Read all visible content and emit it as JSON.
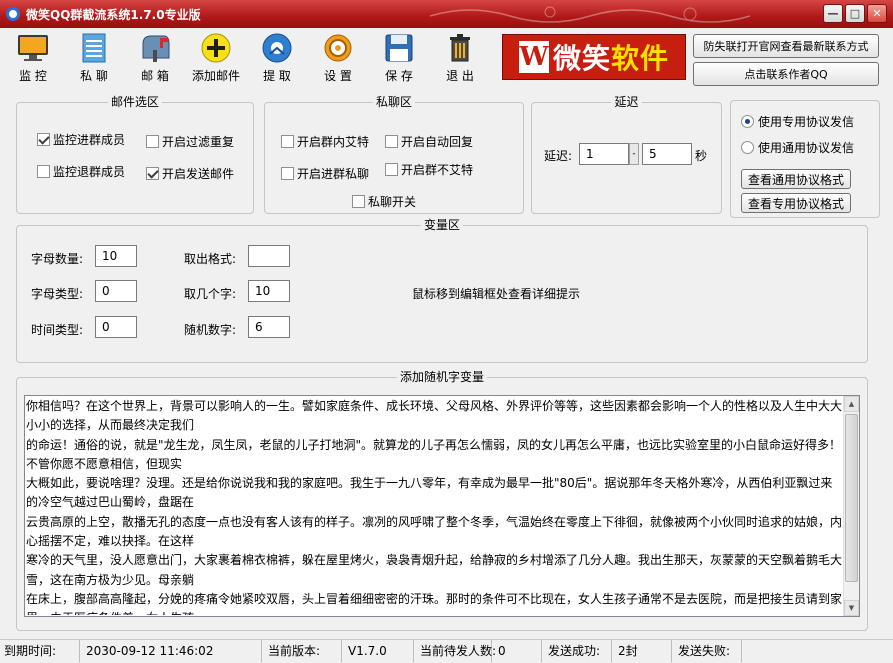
{
  "window": {
    "title": "微笑QQ群截流系统1.7.0专业版",
    "controls": [
      "—",
      "□",
      "✕"
    ]
  },
  "toolbar": {
    "items": [
      {
        "label": "监 控",
        "icon": "monitor-icon"
      },
      {
        "label": "私 聊",
        "icon": "notepad-icon"
      },
      {
        "label": "邮 箱",
        "icon": "mailbox-icon"
      },
      {
        "label": "添加邮件",
        "icon": "add-icon"
      },
      {
        "label": "提 取",
        "icon": "extract-icon"
      },
      {
        "label": "设 置",
        "icon": "gear-icon"
      },
      {
        "label": "保 存",
        "icon": "save-icon"
      },
      {
        "label": "退 出",
        "icon": "trash-icon"
      }
    ],
    "logo_w": "W",
    "logo_text_a": "微笑",
    "logo_text_b": "软件",
    "btn_official": "防失联打开官网查看最新联系方式",
    "btn_contact": "点击联系作者QQ"
  },
  "mail_group": {
    "title": "邮件选区",
    "opt_monitor_join": {
      "label": "监控进群成员",
      "checked": true
    },
    "opt_filter_dup": {
      "label": "开启过滤重复",
      "checked": false
    },
    "opt_monitor_leave": {
      "label": "监控退群成员",
      "checked": false
    },
    "opt_send_mail": {
      "label": "开启发送邮件",
      "checked": true
    }
  },
  "chat_group": {
    "title": "私聊区",
    "opt_at_in_group": {
      "label": "开启群内艾特",
      "checked": false
    },
    "opt_auto_reply": {
      "label": "开启自动回复",
      "checked": false
    },
    "opt_join_chat": {
      "label": "开启进群私聊",
      "checked": false
    },
    "opt_no_at": {
      "label": "开启群不艾特",
      "checked": false
    },
    "opt_chat_switch": {
      "label": "私聊开关",
      "checked": false
    }
  },
  "delay_group": {
    "title": "延迟",
    "label": "延迟:",
    "min": "1",
    "max": "5",
    "sep": "-",
    "unit": "秒"
  },
  "protocol": {
    "opt_dedicated": {
      "label": "使用专用协议发信",
      "checked": true
    },
    "opt_generic": {
      "label": "使用通用协议发信",
      "checked": false
    },
    "btn_view_generic": "查看通用协议格式",
    "btn_view_dedicated": "查看专用协议格式"
  },
  "var_group": {
    "title": "变量区",
    "letter_count_label": "字母数量:",
    "letter_count": "10",
    "letter_type_label": "字母类型:",
    "letter_type": "0",
    "time_type_label": "时间类型:",
    "time_type": "0",
    "take_format_label": "取出格式:",
    "take_format": "",
    "take_count_label": "取几个字:",
    "take_count": "10",
    "random_num_label": "随机数字:",
    "random_num": "6",
    "hint": "鼠标移到编辑框处查看详细提示"
  },
  "random_text": {
    "title": "添加随机字变量",
    "content": "你相信吗？在这个世界上，背景可以影响人的一生。譬如家庭条件、成长环境、父母风格、外界评价等等，这些因素都会影响一个人的性格以及人生中大大小小的选择，从而最终决定我们\n的命运！通俗的说，就是\"龙生龙，凤生凤，老鼠的儿子打地洞\"。就算龙的儿子再怎么懦弱，凤的女儿再怎么平庸，也远比实验室里的小白鼠命运好得多！不管你愿不愿意相信，但现实\n大概如此，要说啥理？没理。还是给你说说我和我的家庭吧。我生于一九八零年，有幸成为最早一批\"80后\"。据说那年冬天格外寒冷，从西伯利亚飘过来的冷空气越过巴山蜀岭，盘踞在\n云贵高原的上空，散播无孔的态度一点也没有客人该有的样子。凛冽的风呼啸了整个冬季，气温始终在零度上下徘徊，就像被两个小伙同时追求的姑娘，内心摇摆不定，难以抉择。在这样\n寒冷的天气里，没人愿意出门，大家裹着棉衣棉裤，躲在屋里烤火，袅袅青烟升起，给静寂的乡村增添了几分人趣。我出生那天，灰蒙蒙的天空飘着鹅毛大雪，这在南方极为少见。母亲躺\n在床上，腹部高高隆起，分娩的疼痛令她紧咬双唇，头上冒着细细密密的汗珠。那时的条件可不比现在，女人生孩子通常不是去医院，而是把接生员请到家里，由于医疗条件差，女人生孩\n子就和跨\"鬼门关\"没什么区别，我们这里每年都有产妇因难产而死亡。替母亲接生的人叫王祖凤，是方圆几十里出了名的接生员。据说，她曾去北京培训过几个月，回来后背着一只里面装\n的、印有红十字的药箱，踏着优越的步子，在乡间一圈一圈转，直到所有人都知道她去过北京！不过任何事物都有两面性，这份令人羡慕的职业也让她的婚姻极为不顺，一方面她瞧不上\n农村小伙，另一方面城里小伙又瞧不上她，在一环又一环的婚姻\"鄙视链\"中，她成了落单的\"老姑娘\"。虽然从没生过孩子，但她接生的技术远近闻名。\n毫不夸张的说，她的出现，让我"
  },
  "status": {
    "expire_label": "到期时间:",
    "expire_value": "2030-09-12 11:46:02",
    "version_label": "当前版本:",
    "version_value": "V1.7.0",
    "pending_label": "当前待发人数:",
    "pending_value": "0",
    "success_label": "发送成功:",
    "success_value": "2封",
    "fail_label": "发送失败:",
    "fail_value": ""
  }
}
